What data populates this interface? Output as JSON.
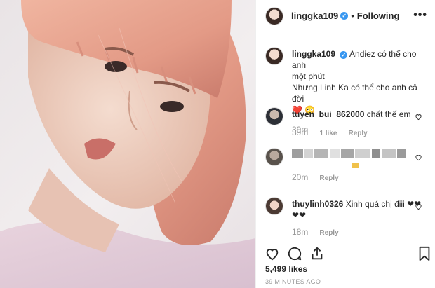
{
  "post": {
    "username": "linggka109",
    "follow_status": "Following",
    "separator": "•",
    "more_label": "•••"
  },
  "caption": {
    "username": "linggka109",
    "text_line1": "Andiez có thể cho anh",
    "text_line2": "một phút",
    "text_line3": "Nhưng Linh Ka có thể cho anh cả đời",
    "emojis": "❤️ 😳",
    "time": "39m"
  },
  "comments": [
    {
      "username": "tuyen_bui_862000",
      "text": "chất thế em",
      "time": "39m",
      "likes": "1 like",
      "reply": "Reply"
    },
    {
      "username": "",
      "text": "",
      "time": "20m",
      "likes": "",
      "reply": "Reply"
    },
    {
      "username": "thuylinh0326",
      "text": "Xinh quá chị điii ❤❤",
      "text_cont": "❤❤",
      "time": "18m",
      "likes": "",
      "reply": "Reply"
    }
  ],
  "footer": {
    "likes": "5,499 likes",
    "timestamp": "39 MINUTES AGO"
  },
  "colors": {
    "verified": "#3897f0",
    "text": "#262626",
    "muted": "#999999",
    "heart": "#ed4956"
  }
}
